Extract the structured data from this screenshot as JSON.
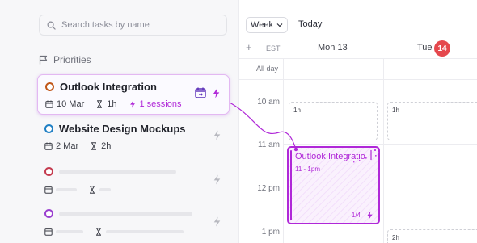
{
  "search": {
    "placeholder": "Search tasks by name",
    "icon": "search-icon"
  },
  "sidebar": {
    "section_title": "Priorities",
    "tasks": [
      {
        "name": "Outlook Integration",
        "color": "#c1571a",
        "date": "10 Mar",
        "duration": "1h",
        "sessions": "1 sessions",
        "active": true
      },
      {
        "name": "Website Design Mockups",
        "color": "#1f7fc4",
        "date": "2 Mar",
        "duration": "2h"
      },
      {
        "name": "",
        "color": "#c43a4e",
        "placeholder": true
      },
      {
        "name": "",
        "color": "#9a3fcf",
        "placeholder": true
      }
    ]
  },
  "calendar": {
    "view": "Week",
    "today_label": "Today",
    "add_symbol": "+",
    "timezone": "EST",
    "days": [
      {
        "label": "Mon 13"
      },
      {
        "label": "Tue",
        "badge": "14"
      }
    ],
    "allday_label": "All day",
    "times": [
      "10 am",
      "11 am",
      "12 pm",
      "1 pm"
    ],
    "slots": [
      {
        "label": "1h"
      },
      {
        "label": "1h"
      },
      {
        "label": "2h"
      }
    ],
    "event": {
      "title": "Outlook Integratio",
      "time": "11 - 1pm",
      "progress": "1/4",
      "color": "#b028d8"
    }
  },
  "colors": {
    "accent": "#b028d8",
    "today_badge": "#e5484d"
  }
}
